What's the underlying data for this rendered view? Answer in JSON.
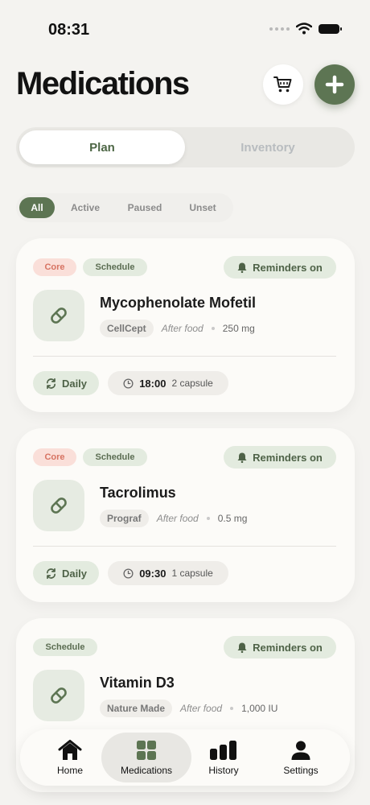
{
  "status_bar": {
    "time": "08:31"
  },
  "header": {
    "title": "Medications"
  },
  "segment": {
    "plan": "Plan",
    "inventory": "Inventory"
  },
  "filters": {
    "all": "All",
    "active": "Active",
    "paused": "Paused",
    "unset": "Unset"
  },
  "cards": [
    {
      "tags": [
        "Core",
        "Schedule"
      ],
      "reminder": "Reminders on",
      "name": "Mycophenolate Mofetil",
      "brand": "CellCept",
      "food": "After food",
      "dose": "250 mg",
      "frequency": "Daily",
      "time": "18:00",
      "quantity": "2 capsule"
    },
    {
      "tags": [
        "Core",
        "Schedule"
      ],
      "reminder": "Reminders on",
      "name": "Tacrolimus",
      "brand": "Prograf",
      "food": "After food",
      "dose": "0.5 mg",
      "frequency": "Daily",
      "time": "09:30",
      "quantity": "1 capsule"
    },
    {
      "tags": [
        "Schedule"
      ],
      "reminder": "Reminders on",
      "name": "Vitamin D3",
      "brand": "Nature Made",
      "food": "After food",
      "dose": "1,000 IU"
    }
  ],
  "tabbar": {
    "home": "Home",
    "medications": "Medications",
    "history": "History",
    "settings": "Settings",
    "active": "Medications"
  },
  "colors": {
    "accent": "#5d7553",
    "core_tag": "#d77362",
    "background": "#f4f3f0"
  },
  "icons": [
    "signal-icon",
    "wifi-icon",
    "battery-icon",
    "cart-icon",
    "plus-icon",
    "bell-icon",
    "pill-icon",
    "repeat-icon",
    "clock-icon",
    "home-icon",
    "grid-icon",
    "bar-chart-icon",
    "person-icon"
  ]
}
